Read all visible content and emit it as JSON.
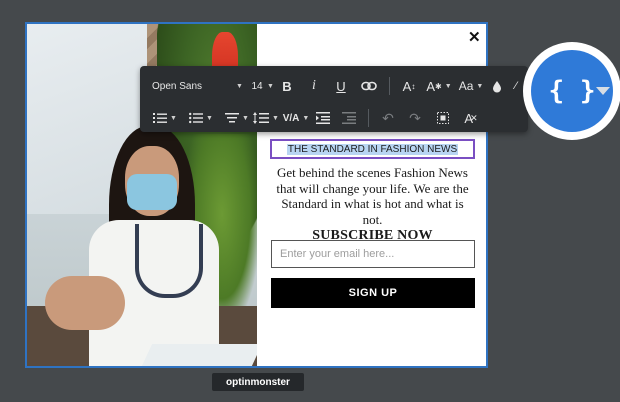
{
  "popup": {
    "close_symbol": "✕",
    "headline": "THE STANDARD IN FASHION NEWS",
    "body": "Get behind the scenes Fashion News that will change your life. We are the Standard in what is hot and what is not.",
    "cta_text": "SUBSCRIBE NOW",
    "email_placeholder": "Enter your email here...",
    "button_label": "SIGN UP"
  },
  "toolbar": {
    "font_family": "Open Sans",
    "font_size": "14",
    "bold": "B",
    "italic": "i",
    "underline": "U",
    "line_height_label": "V/A"
  },
  "bubble": {
    "label": "{ }"
  },
  "brand": {
    "name": "optinmonster"
  },
  "colors": {
    "background": "#45494c",
    "accent_blue": "#2f7ad8",
    "selection_border": "#7a4fc2",
    "toolbar_bg": "#2b2e31"
  }
}
